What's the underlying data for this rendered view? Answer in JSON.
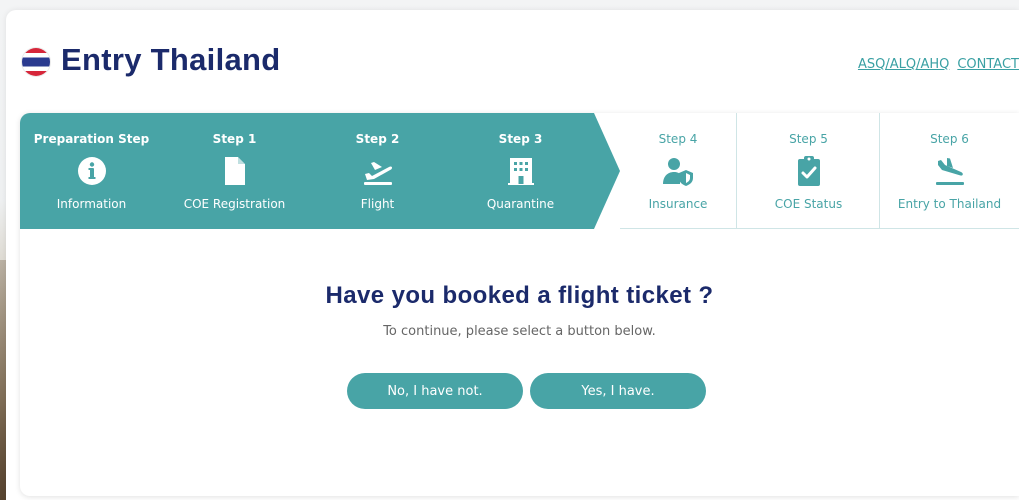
{
  "header": {
    "brand": "Entry Thailand",
    "links": [
      "ASQ/ALQ/AHQ",
      "CONTACT"
    ]
  },
  "steps": [
    {
      "number": "Preparation Step",
      "label": "Information",
      "icon": "info-circle-icon",
      "state": "done"
    },
    {
      "number": "Step 1",
      "label": "COE Registration",
      "icon": "document-icon",
      "state": "done"
    },
    {
      "number": "Step 2",
      "label": "Flight",
      "icon": "plane-takeoff-icon",
      "state": "done"
    },
    {
      "number": "Step 3",
      "label": "Quarantine",
      "icon": "hotel-building-icon",
      "state": "done"
    },
    {
      "number": "Step 4",
      "label": "Insurance",
      "icon": "user-shield-icon",
      "state": "todo"
    },
    {
      "number": "Step 5",
      "label": "COE Status",
      "icon": "clipboard-check-icon",
      "state": "todo"
    },
    {
      "number": "Step 6",
      "label": "Entry to Thailand",
      "icon": "plane-landing-icon",
      "state": "todo"
    }
  ],
  "main": {
    "question": "Have you booked a flight ticket ?",
    "subtext": "To continue, please select a button below.",
    "no_label": "No, I have not.",
    "yes_label": "Yes, I have."
  },
  "colors": {
    "accent": "#48a4a6",
    "brand": "#1b2a6b"
  }
}
